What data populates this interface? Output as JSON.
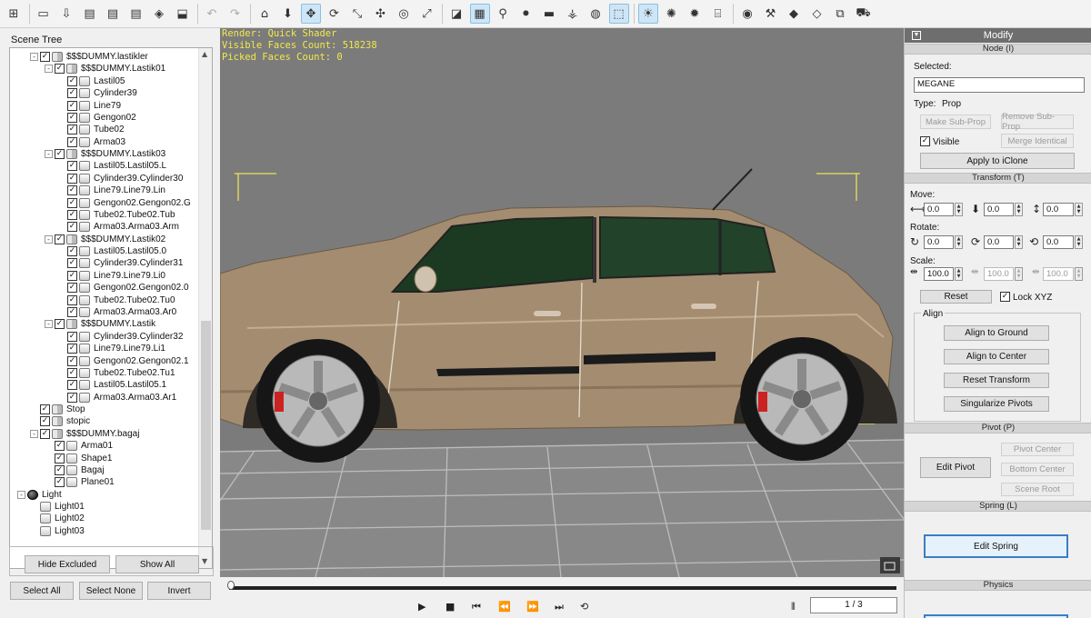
{
  "toolbar": {
    "icons": [
      "scene-tree-icon",
      "open-folder-icon",
      "import-icon",
      "export-pdf-icon",
      "export-svg-icon",
      "export-obj-icon",
      "load-icon",
      "save-icon",
      "undo-icon",
      "redo-icon",
      "home-icon",
      "move-down-icon",
      "move-icon",
      "rotate-icon",
      "scale-icon",
      "pan-icon",
      "orbit-icon",
      "fit-icon",
      "wireframe-icon",
      "grid-icon",
      "bone-icon",
      "pin-icon",
      "box-icon",
      "camera-icon",
      "sphere-icon",
      "select-icon",
      "light-icon",
      "spotlight-icon",
      "sun-icon",
      "museum-icon",
      "globe-icon",
      "wrench-icon",
      "paint-icon",
      "paint-bucket-icon",
      "copy-icon",
      "cart-icon"
    ],
    "active": [
      12,
      19,
      25,
      26
    ]
  },
  "scene_tree": {
    "title": "Scene Tree",
    "rows": [
      {
        "depth": 1,
        "exp": "-",
        "chk": true,
        "icon": "grp",
        "label": "$$$DUMMY.lastikler"
      },
      {
        "depth": 2,
        "exp": "-",
        "chk": true,
        "icon": "grp",
        "label": "$$$DUMMY.Lastik01"
      },
      {
        "depth": 3,
        "exp": "",
        "chk": true,
        "icon": "mesh",
        "label": "Lastil05"
      },
      {
        "depth": 3,
        "exp": "",
        "chk": true,
        "icon": "mesh",
        "label": "Cylinder39"
      },
      {
        "depth": 3,
        "exp": "",
        "chk": true,
        "icon": "mesh",
        "label": "Line79"
      },
      {
        "depth": 3,
        "exp": "",
        "chk": true,
        "icon": "mesh",
        "label": "Gengon02"
      },
      {
        "depth": 3,
        "exp": "",
        "chk": true,
        "icon": "mesh",
        "label": "Tube02"
      },
      {
        "depth": 3,
        "exp": "",
        "chk": true,
        "icon": "mesh",
        "label": "Arma03"
      },
      {
        "depth": 2,
        "exp": "-",
        "chk": true,
        "icon": "grp",
        "label": "$$$DUMMY.Lastik03"
      },
      {
        "depth": 3,
        "exp": "",
        "chk": true,
        "icon": "mesh",
        "label": "Lastil05.Lastil05.L"
      },
      {
        "depth": 3,
        "exp": "",
        "chk": true,
        "icon": "mesh",
        "label": "Cylinder39.Cylinder30"
      },
      {
        "depth": 3,
        "exp": "",
        "chk": true,
        "icon": "mesh",
        "label": "Line79.Line79.Lin"
      },
      {
        "depth": 3,
        "exp": "",
        "chk": true,
        "icon": "mesh",
        "label": "Gengon02.Gengon02.G"
      },
      {
        "depth": 3,
        "exp": "",
        "chk": true,
        "icon": "mesh",
        "label": "Tube02.Tube02.Tub"
      },
      {
        "depth": 3,
        "exp": "",
        "chk": true,
        "icon": "mesh",
        "label": "Arma03.Arma03.Arm"
      },
      {
        "depth": 2,
        "exp": "-",
        "chk": true,
        "icon": "grp",
        "label": "$$$DUMMY.Lastik02"
      },
      {
        "depth": 3,
        "exp": "",
        "chk": true,
        "icon": "mesh",
        "label": "Lastil05.Lastil05.0"
      },
      {
        "depth": 3,
        "exp": "",
        "chk": true,
        "icon": "mesh",
        "label": "Cylinder39.Cylinder31"
      },
      {
        "depth": 3,
        "exp": "",
        "chk": true,
        "icon": "mesh",
        "label": "Line79.Line79.Li0"
      },
      {
        "depth": 3,
        "exp": "",
        "chk": true,
        "icon": "mesh",
        "label": "Gengon02.Gengon02.0"
      },
      {
        "depth": 3,
        "exp": "",
        "chk": true,
        "icon": "mesh",
        "label": "Tube02.Tube02.Tu0"
      },
      {
        "depth": 3,
        "exp": "",
        "chk": true,
        "icon": "mesh",
        "label": "Arma03.Arma03.Ar0"
      },
      {
        "depth": 2,
        "exp": "-",
        "chk": true,
        "icon": "grp",
        "label": "$$$DUMMY.Lastik"
      },
      {
        "depth": 3,
        "exp": "",
        "chk": true,
        "icon": "mesh",
        "label": "Cylinder39.Cylinder32"
      },
      {
        "depth": 3,
        "exp": "",
        "chk": true,
        "icon": "mesh",
        "label": "Line79.Line79.Li1"
      },
      {
        "depth": 3,
        "exp": "",
        "chk": true,
        "icon": "mesh",
        "label": "Gengon02.Gengon02.1"
      },
      {
        "depth": 3,
        "exp": "",
        "chk": true,
        "icon": "mesh",
        "label": "Tube02.Tube02.Tu1"
      },
      {
        "depth": 3,
        "exp": "",
        "chk": true,
        "icon": "mesh",
        "label": "Lastil05.Lastil05.1"
      },
      {
        "depth": 3,
        "exp": "",
        "chk": true,
        "icon": "mesh",
        "label": "Arma03.Arma03.Ar1"
      },
      {
        "depth": 1,
        "exp": "",
        "chk": true,
        "icon": "grp",
        "label": "Stop"
      },
      {
        "depth": 1,
        "exp": "",
        "chk": true,
        "icon": "grp",
        "label": "stopic"
      },
      {
        "depth": 1,
        "exp": "-",
        "chk": true,
        "icon": "grp",
        "label": "$$$DUMMY.bagaj"
      },
      {
        "depth": 2,
        "exp": "",
        "chk": true,
        "icon": "mesh",
        "label": "Arma01"
      },
      {
        "depth": 2,
        "exp": "",
        "chk": true,
        "icon": "mesh",
        "label": "Shape1"
      },
      {
        "depth": 2,
        "exp": "",
        "chk": true,
        "icon": "mesh",
        "label": "Bagaj"
      },
      {
        "depth": 2,
        "exp": "",
        "chk": true,
        "icon": "mesh",
        "label": "Plane01"
      },
      {
        "depth": 0,
        "exp": "-",
        "chk": null,
        "icon": "ball",
        "label": "Light"
      },
      {
        "depth": 1,
        "exp": "",
        "chk": null,
        "icon": "mesh",
        "label": "Light01"
      },
      {
        "depth": 1,
        "exp": "",
        "chk": null,
        "icon": "mesh",
        "label": "Light02"
      },
      {
        "depth": 1,
        "exp": "",
        "chk": null,
        "icon": "mesh",
        "label": "Light03"
      }
    ],
    "buttons": {
      "hide_excluded": "Hide Excluded",
      "show_all": "Show All",
      "select_all": "Select All",
      "select_none": "Select None",
      "invert": "Invert"
    }
  },
  "viewport": {
    "render": "Render: Quick Shader",
    "visible_faces": "Visible Faces Count: 518238",
    "picked_faces": "Picked Faces Count: 0",
    "stat_color": "#f2e94a",
    "background_color": "#7b7b7b",
    "car_color": "#a48c70"
  },
  "timeline": {
    "frame": "1 / 3",
    "controls": [
      "play-icon",
      "stop-icon",
      "previous-key-icon",
      "rewind-icon",
      "fast-forward-icon",
      "next-key-icon",
      "loop-icon"
    ]
  },
  "modify": {
    "title": "Modify",
    "node_section": "Node (I)",
    "selected_label": "Selected:",
    "selected_value": "MEGANE",
    "type_label": "Type:",
    "type_value": "Prop",
    "make_sub_prop": "Make Sub-Prop",
    "remove_sub_prop": "Remove Sub-Prop",
    "visible_label": "Visible",
    "merge_identical": "Merge Identical",
    "apply_to_iclone": "Apply to iClone",
    "transform_section": "Transform (T)",
    "move_label": "Move:",
    "rotate_label": "Rotate:",
    "scale_label": "Scale:",
    "move": [
      "0.0",
      "0.0",
      "0.0"
    ],
    "rotate": [
      "0.0",
      "0.0",
      "0.0"
    ],
    "scale": [
      "100.0",
      "100.0",
      "100.0"
    ],
    "reset": "Reset",
    "lock_xyz": "Lock XYZ",
    "align_title": "Align",
    "align_to_ground": "Align to Ground",
    "align_to_center": "Align to Center",
    "reset_transform": "Reset Transform",
    "singularize_pivots": "Singularize Pivots",
    "pivot_section": "Pivot (P)",
    "edit_pivot": "Edit Pivot",
    "pivot_center": "Pivot Center",
    "bottom_center": "Bottom Center",
    "scene_root": "Scene Root",
    "spring_section": "Spring (L)",
    "edit_spring": "Edit Spring",
    "physics_section": "Physics"
  }
}
